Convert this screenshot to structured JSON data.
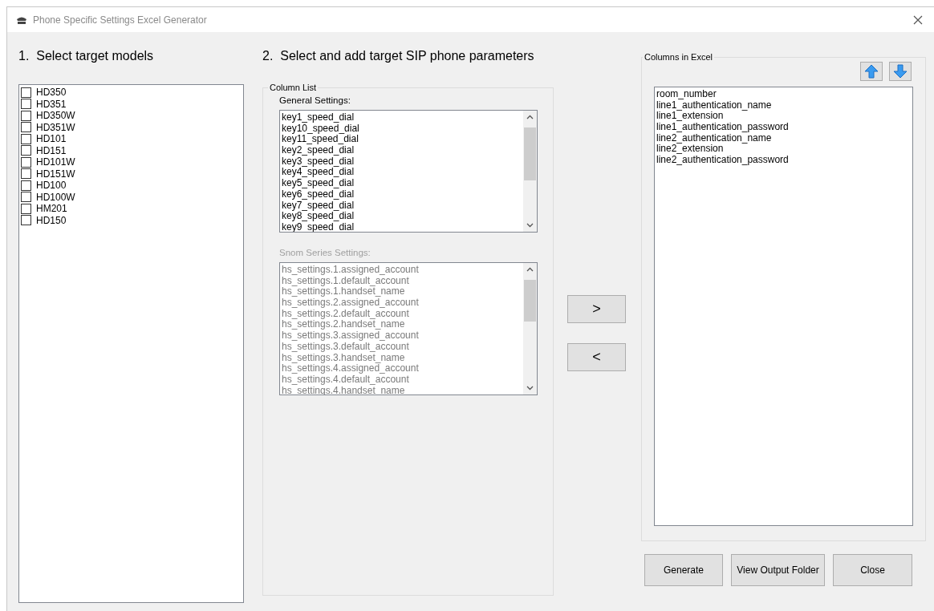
{
  "window": {
    "title": "Phone Specific Settings Excel Generator"
  },
  "models": {
    "heading": "1.  Select target models",
    "items": [
      {
        "label": "HD350",
        "checked": false
      },
      {
        "label": "HD351",
        "checked": false
      },
      {
        "label": "HD350W",
        "checked": false
      },
      {
        "label": "HD351W",
        "checked": false
      },
      {
        "label": "HD101",
        "checked": false
      },
      {
        "label": "HD151",
        "checked": false
      },
      {
        "label": "HD101W",
        "checked": false
      },
      {
        "label": "HD151W",
        "checked": false
      },
      {
        "label": "HD100",
        "checked": false
      },
      {
        "label": "HD100W",
        "checked": false
      },
      {
        "label": "HM201",
        "checked": false
      },
      {
        "label": "HD150",
        "checked": false
      }
    ]
  },
  "parameters": {
    "heading": "2.  Select and add target SIP phone parameters",
    "group_title": "Column List",
    "lists": [
      {
        "label": "General Settings:",
        "disabled": false,
        "items": [
          "key1_speed_dial",
          "key10_speed_dial",
          "key11_speed_dial",
          "key2_speed_dial",
          "key3_speed_dial",
          "key4_speed_dial",
          "key5_speed_dial",
          "key6_speed_dial",
          "key7_speed_dial",
          "key8_speed_dial",
          "key9_speed_dial"
        ]
      },
      {
        "label": "Snom Series Settings:",
        "disabled": true,
        "items": [
          "hs_settings.1.assigned_account",
          "hs_settings.1.default_account",
          "hs_settings.1.handset_name",
          "hs_settings.2.assigned_account",
          "hs_settings.2.default_account",
          "hs_settings.2.handset_name",
          "hs_settings.3.assigned_account",
          "hs_settings.3.default_account",
          "hs_settings.3.handset_name",
          "hs_settings.4.assigned_account",
          "hs_settings.4.default_account",
          "hs_settings.4.handset_name"
        ]
      }
    ]
  },
  "transfer_buttons": [
    ">",
    "<"
  ],
  "excel_columns": {
    "group_title": "Columns in Excel",
    "items": [
      "room_number",
      "line1_authentication_name",
      "line1_extension",
      "line1_authentication_password",
      "line2_authentication_name",
      "line2_extension",
      "line2_authentication_password"
    ]
  },
  "buttons": [
    "Generate",
    "View Output Folder",
    "Close"
  ]
}
